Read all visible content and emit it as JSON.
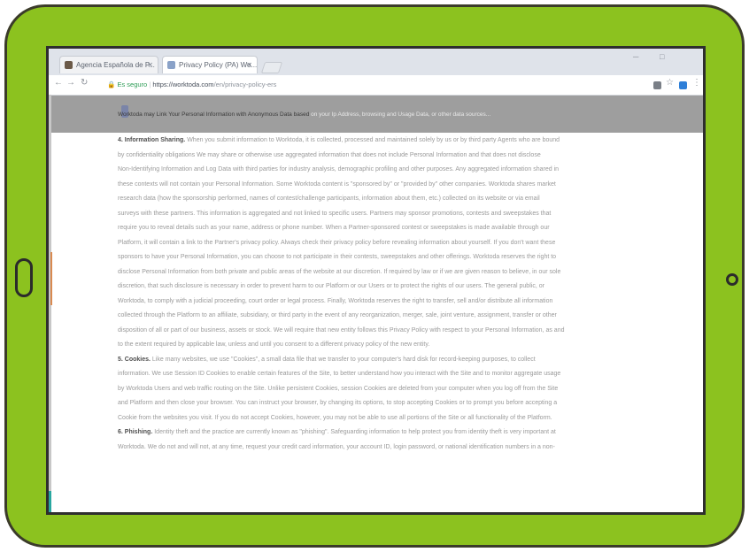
{
  "browser": {
    "tabs": [
      {
        "label": "Agencia Española de P..."
      },
      {
        "label": "Privacy Policy (PA) Wo..."
      }
    ],
    "window_controls": [
      "─",
      "□"
    ],
    "address": {
      "secure_label": "Es seguro",
      "url": "https://worktoda.com",
      "path": "/en/privacy-policy-ers"
    }
  },
  "banner": {
    "text": "Worktoda may Link Your Personal Information with Anonymous Data based ",
    "muted": "on your Ip Address, browsing and Usage Data, or other data sources..."
  },
  "paragraphs": [
    {
      "lead": "4. Information Sharing.",
      "lines": [
        "When you submit information to Worktoda, it is collected, processed and maintained solely by us or by third party Agents who are bound",
        "by confidentiality obligations We may share or otherwise use aggregated information that does not include Personal Information and that does not disclose",
        "Non-Identifying Information and Log Data with third parties for industry analysis, demographic profiling and other purposes. Any aggregated information shared in",
        "these contexts will not contain your Personal Information. Some Worktoda content is \"sponsored by\" or \"provided by\" other companies. Worktoda shares market",
        "research data (how the sponsorship performed, names of contest/challenge participants, information about them, etc.) collected on its website or via email",
        "surveys with these partners. This information is aggregated and not linked to specific users. Partners may sponsor promotions, contests and sweepstakes that",
        "require you to reveal details such as your name, address or phone number. When a Partner-sponsored contest or sweepstakes is made available through our",
        "Platform, it will contain a link to the Partner's privacy policy. Always check their privacy policy before revealing information about yourself. If you don't want these",
        "sponsors to have your Personal Information, you can choose to not participate in their contests, sweepstakes and other offerings. Worktoda reserves the right to",
        "disclose Personal Information from both private and public areas of the website at our discretion. If required by law or if we are given reason to believe, in our sole",
        "discretion, that such disclosure is necessary in order to prevent harm to our Platform or our Users or to protect the rights of our users. The general public, or",
        "Worktoda, to comply with a judicial proceeding, court order or legal process. Finally, Worktoda reserves the right to transfer, sell and/or distribute all information",
        "collected through the Platform to an affiliate, subsidiary, or third party in the event of any reorganization, merger, sale, joint venture, assignment, transfer or other",
        "disposition of all or part of our business, assets or stock. We will require that new entity follows this Privacy Policy with respect to your Personal Information, as and",
        "to the extent required by applicable law, unless and until you consent to a different privacy policy of the new entity."
      ]
    },
    {
      "lead": "5. Cookies.",
      "lines": [
        "Like many websites, we use \"Cookies\", a small data file that we transfer to your computer's hard disk for record-keeping purposes, to collect",
        "information. We use Session ID Cookies to enable certain features of the Site, to better understand how you interact with the Site and to monitor aggregate usage",
        "by Worktoda Users and web traffic routing on the Site. Unlike persistent Cookies, session Cookies are deleted from your computer when you log off from the Site",
        "and Platform and then close your browser. You can instruct your browser, by changing its options, to stop accepting Cookies or to prompt you before accepting a",
        "Cookie from the websites you visit. If you do not accept Cookies, however, you may not be able to use all portions of the Site or all functionality of the Platform."
      ]
    },
    {
      "lead": "6. Phishing.",
      "lines": [
        "Identity theft and the practice are currently known as \"phishing\". Safeguarding information to help protect you from identity theft is very important at",
        "Worktoda. We do not and will not, at any time, request your credit card information, your account ID, login password, or national identification numbers in a non-"
      ]
    }
  ]
}
